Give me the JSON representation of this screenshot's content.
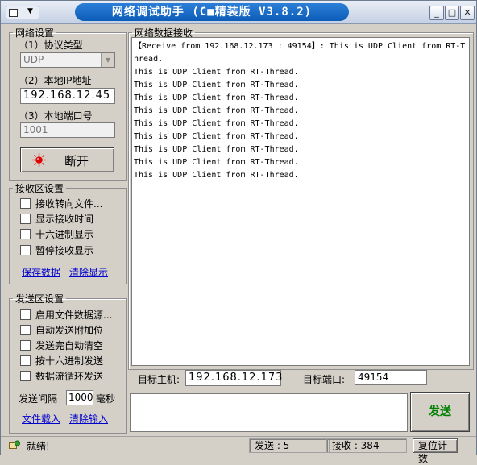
{
  "window": {
    "title": "网络调试助手 (C■精装版 V3.8.2)",
    "minimize_glyph": "_",
    "maximize_glyph": "□",
    "close_glyph": "✕"
  },
  "net": {
    "group_title": "网络设置",
    "protocol_label": "（1）协议类型",
    "protocol_value": "UDP",
    "ip_label": "（2）本地IP地址",
    "ip_value": "192.168.12.45",
    "port_label": "（3）本地端口号",
    "port_value": "1001",
    "disconnect_label": "断开"
  },
  "recv_settings": {
    "group_title": "接收区设置",
    "options": [
      "接收转向文件...",
      "显示接收时间",
      "十六进制显示",
      "暂停接收显示"
    ],
    "save_link": "保存数据",
    "clear_link": "清除显示"
  },
  "send_settings": {
    "group_title": "发送区设置",
    "options": [
      "启用文件数据源...",
      "自动发送附加位",
      "发送完自动清空",
      "按十六进制发送",
      "数据流循环发送"
    ],
    "interval_label": "发送间隔",
    "interval_value": "1000",
    "interval_unit": "毫秒",
    "load_file_link": "文件载入",
    "clear_input_link": "清除输入"
  },
  "recv_area": {
    "title": "网络数据接收",
    "lines": [
      "【Receive from 192.168.12.173 : 49154】: This is UDP Client from RT-Thread.",
      "This is UDP Client from RT-Thread.",
      "This is UDP Client from RT-Thread.",
      "This is UDP Client from RT-Thread.",
      "This is UDP Client from RT-Thread.",
      "This is UDP Client from RT-Thread.",
      "This is UDP Client from RT-Thread.",
      "This is UDP Client from RT-Thread.",
      "This is UDP Client from RT-Thread.",
      "This is UDP Client from RT-Thread."
    ]
  },
  "target": {
    "host_label": "目标主机:",
    "host_value": "192.168.12.173",
    "port_label": "目标端口:",
    "port_value": "49154"
  },
  "send_button": "发送",
  "status": {
    "ready": "就绪!",
    "sent": "发送 : 5",
    "received": "接收 : 384",
    "reset": "复位计数"
  },
  "colors": {
    "title_accent": "#0c5cb8",
    "link": "#0000cc",
    "send_text": "#008000",
    "led": "#e00000"
  }
}
